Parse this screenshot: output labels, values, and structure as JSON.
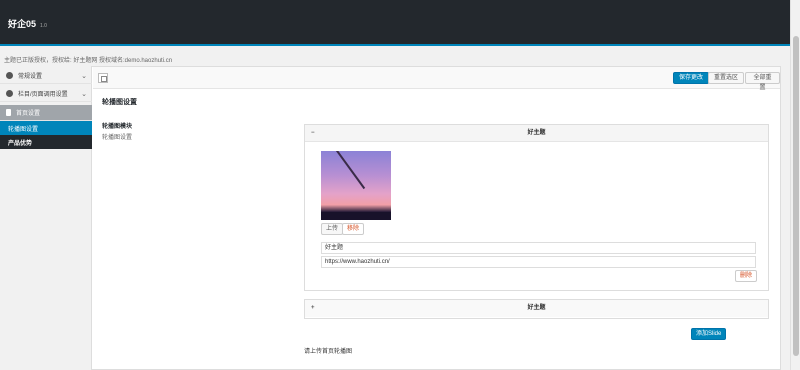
{
  "header": {
    "title": "好企05",
    "version": "1.0"
  },
  "notice": "主题已正版授权，授权给: 好主题网 授权域名:demo.haozhuti.cn",
  "sidebar": {
    "items": [
      {
        "label": "常规设置",
        "icon": "wordpress-icon"
      },
      {
        "label": "栏目/页面调用设置",
        "icon": "wordpress-icon"
      },
      {
        "label": "首页设置",
        "icon": "bookmark-icon"
      }
    ],
    "subitems": [
      {
        "label": "轮播图设置"
      },
      {
        "label": "产品优势"
      }
    ]
  },
  "toolbar": {
    "save_label": "保存更改",
    "reset_section_label": "重置选区",
    "reset_all_label": "全部重置"
  },
  "section": {
    "title": "轮播图设置",
    "field_label": "轮播图模块",
    "field_desc": "轮播图设置"
  },
  "slides": [
    {
      "sign": "−",
      "title": "好主题",
      "upload_label": "上传",
      "remove_label": "移除",
      "title_value": "好主题",
      "url_value": "https://www.haozhuti.cn/",
      "delete_label": "删除"
    },
    {
      "sign": "+",
      "title": "好主题"
    }
  ],
  "add_slide_label": "添加Slide",
  "footer_note": "请上传首页轮播图",
  "colors": {
    "accent": "#0085ba",
    "topbar": "#23282d",
    "danger": "#d54e21"
  }
}
